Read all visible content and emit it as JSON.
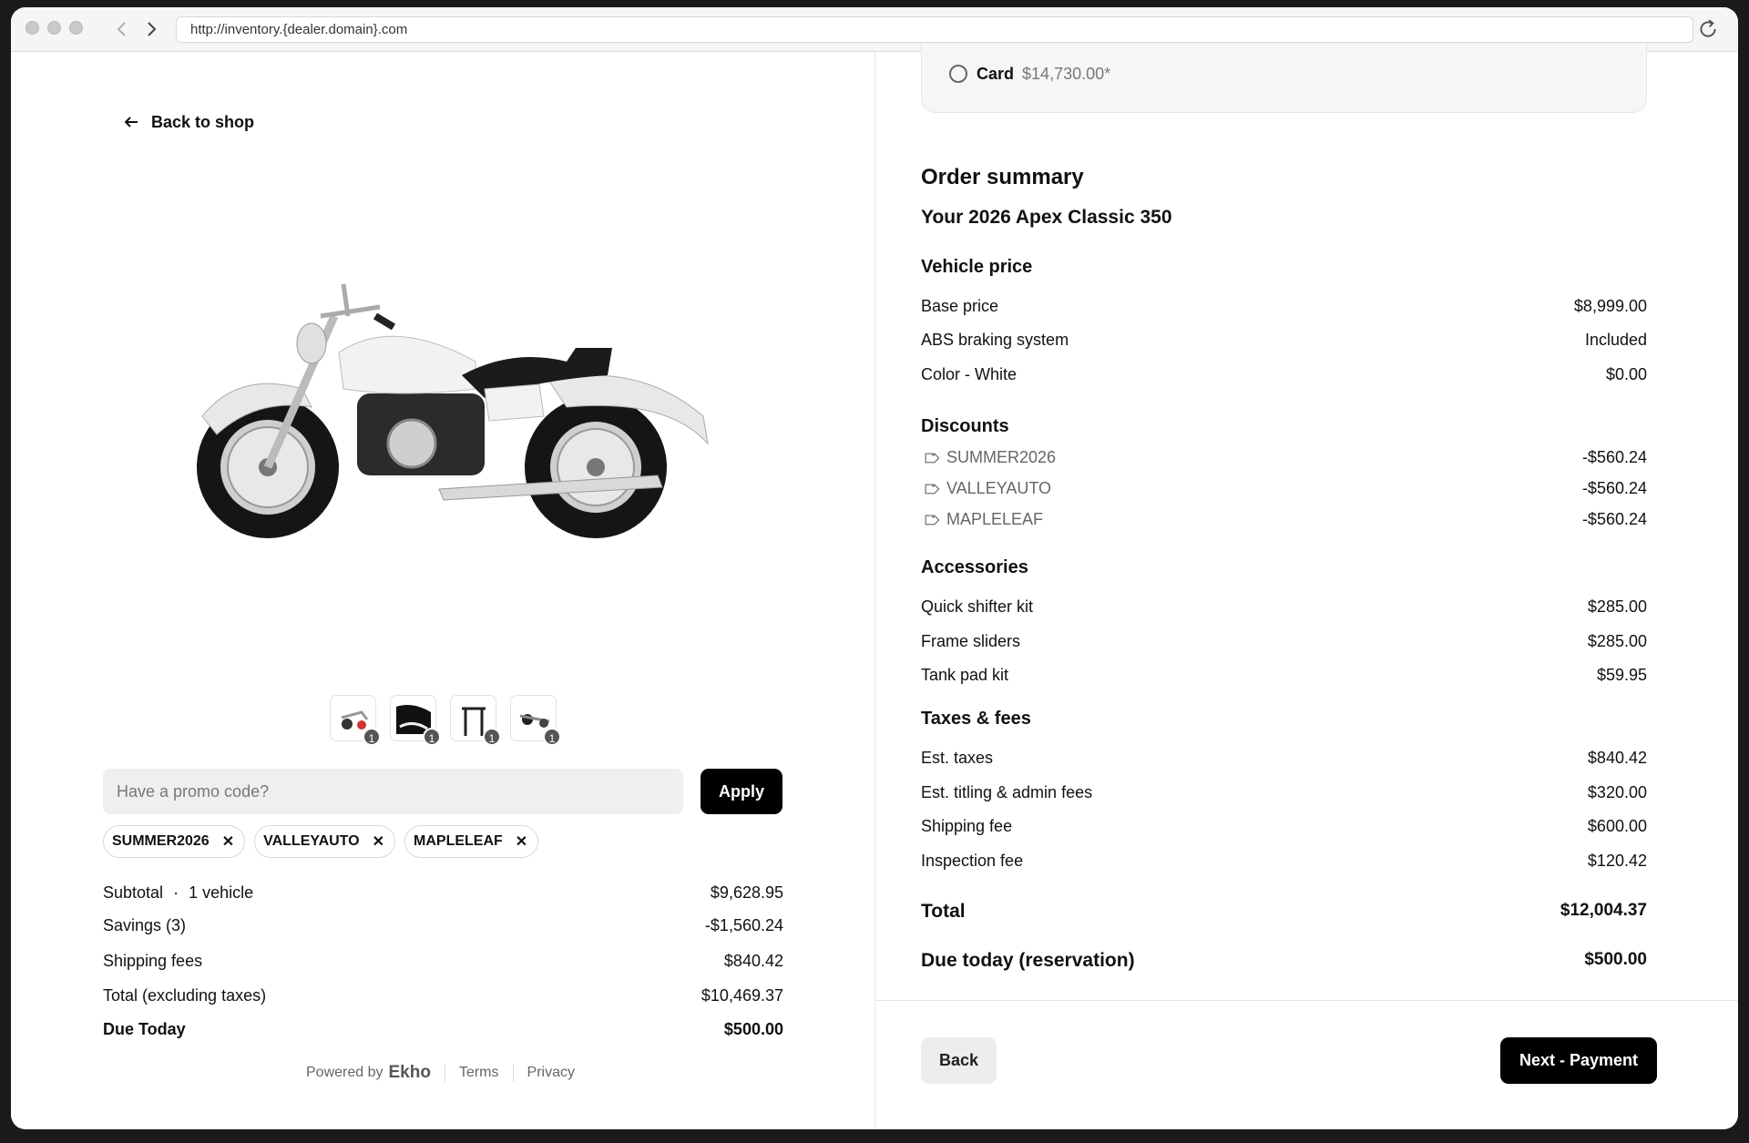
{
  "browser": {
    "url": "http://inventory.{dealer.domain}.com"
  },
  "left": {
    "back_link": "Back to shop",
    "thumbnails": [
      {
        "name": "thumb-controls",
        "badge": "1"
      },
      {
        "name": "thumb-seat",
        "badge": "1"
      },
      {
        "name": "thumb-stand",
        "badge": "1"
      },
      {
        "name": "thumb-shifter",
        "badge": "1"
      }
    ],
    "promo": {
      "placeholder": "Have a promo code?",
      "apply_label": "Apply",
      "codes": [
        "SUMMER2026",
        "VALLEYAUTO",
        "MAPLELEAF"
      ],
      "remove_glyph": "✕"
    },
    "summary": {
      "subtotal_label": "Subtotal",
      "subtotal_dot": "·",
      "subtotal_qty": "1 vehicle",
      "subtotal_value": "$9,628.95",
      "savings_label": "Savings (3)",
      "savings_value": "-$1,560.24",
      "shipping_label": "Shipping fees",
      "shipping_value": "$840.42",
      "total_label": "Total (excluding taxes)",
      "total_value": "$10,469.37",
      "due_label": "Due Today",
      "due_value": "$500.00"
    },
    "footer": {
      "powered_by": "Powered by",
      "brand": "Ekho",
      "terms": "Terms",
      "privacy": "Privacy"
    }
  },
  "right": {
    "card_option": {
      "label": "Card",
      "price": "$14,730.00*"
    },
    "title": "Order summary",
    "vehicle_name": "Your 2026 Apex Classic 350",
    "vehicle_price": {
      "heading": "Vehicle price",
      "items": [
        {
          "label": "Base price",
          "value": "$8,999.00"
        },
        {
          "label": "ABS braking system",
          "value": "Included"
        },
        {
          "label": "Color - White",
          "value": "$0.00"
        }
      ]
    },
    "discounts": {
      "heading": "Discounts",
      "items": [
        {
          "label": "SUMMER2026",
          "value": "-$560.24"
        },
        {
          "label": "VALLEYAUTO",
          "value": "-$560.24"
        },
        {
          "label": "MAPLELEAF",
          "value": "-$560.24"
        }
      ]
    },
    "accessories": {
      "heading": "Accessories",
      "items": [
        {
          "label": "Quick shifter kit",
          "value": "$285.00"
        },
        {
          "label": "Frame sliders",
          "value": "$285.00"
        },
        {
          "label": "Tank pad kit",
          "value": "$59.95"
        }
      ]
    },
    "taxes": {
      "heading": "Taxes & fees",
      "items": [
        {
          "label": "Est. taxes",
          "value": "$840.42"
        },
        {
          "label": "Est. titling & admin fees",
          "value": "$320.00"
        },
        {
          "label": "Shipping fee",
          "value": "$600.00"
        },
        {
          "label": "Inspection fee",
          "value": "$120.42"
        }
      ]
    },
    "total_label": "Total",
    "total_value": "$12,004.37",
    "due_label": "Due today (reservation)",
    "due_value": "$500.00",
    "back_button": "Back",
    "next_button": "Next - Payment"
  }
}
